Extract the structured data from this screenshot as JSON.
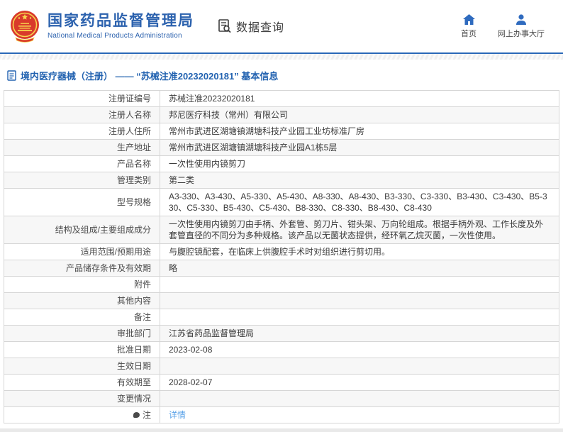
{
  "header": {
    "title": "国家药品监督管理局",
    "subtitle": "National Medical Products Administration",
    "data_query_label": "数据查询",
    "nav_home": "首页",
    "nav_hall": "网上办事大厅"
  },
  "breadcrumb": {
    "text": "境内医疗器械（注册） —— “苏械注准20232020181” 基本信息"
  },
  "table": {
    "rows": [
      {
        "label": "注册证编号",
        "value": "苏械注准20232020181"
      },
      {
        "label": "注册人名称",
        "value": "邦尼医疗科技（常州）有限公司"
      },
      {
        "label": "注册人住所",
        "value": "常州市武进区湖塘镇湖塘科技产业园工业坊标准厂房"
      },
      {
        "label": "生产地址",
        "value": "常州市武进区湖塘镇湖塘科技产业园A1栋5层"
      },
      {
        "label": "产品名称",
        "value": "一次性使用内镜剪刀"
      },
      {
        "label": "管理类别",
        "value": "第二类"
      },
      {
        "label": "型号规格",
        "value": "A3-330、A3-430、A5-330、A5-430、A8-330、A8-430、B3-330、C3-330、B3-430、C3-430、B5-330、C5-330、B5-430、C5-430、B8-330、C8-330、B8-430、C8-430"
      },
      {
        "label": "结构及组成/主要组成成分",
        "value": "一次性使用内镜剪刀由手柄、外套管、剪刀片、钳头架、万向轮组成。根据手柄外观、工作长度及外套管直径的不同分为多种规格。该产品以无菌状态提供，经环氧乙烷灭菌，一次性使用。"
      },
      {
        "label": "适用范围/预期用途",
        "value": "与腹腔镜配套，在临床上供腹腔手术时对组织进行剪切用。"
      },
      {
        "label": "产品储存条件及有效期",
        "value": "略"
      },
      {
        "label": "附件",
        "value": ""
      },
      {
        "label": "其他内容",
        "value": ""
      },
      {
        "label": "备注",
        "value": ""
      },
      {
        "label": "审批部门",
        "value": "江苏省药品监督管理局"
      },
      {
        "label": "批准日期",
        "value": "2023-02-08"
      },
      {
        "label": "生效日期",
        "value": ""
      },
      {
        "label": "有效期至",
        "value": "2028-02-07"
      },
      {
        "label": "变更情况",
        "value": ""
      },
      {
        "label": "注",
        "value": "详情",
        "link": true,
        "icon": "note-icon"
      }
    ]
  },
  "colors": {
    "brand_blue": "#2c62ae",
    "nav_icon_blue": "#2f6bbf",
    "header_rule_blue": "#2a68b7",
    "breadcrumb_blue": "#2262b0",
    "link_blue": "#5aa2e8",
    "row_alt_bg": "#f7f7f7",
    "table_border": "#d6d6d6",
    "emblem_red": "#d93a2b",
    "emblem_gold": "#f7d64e"
  }
}
